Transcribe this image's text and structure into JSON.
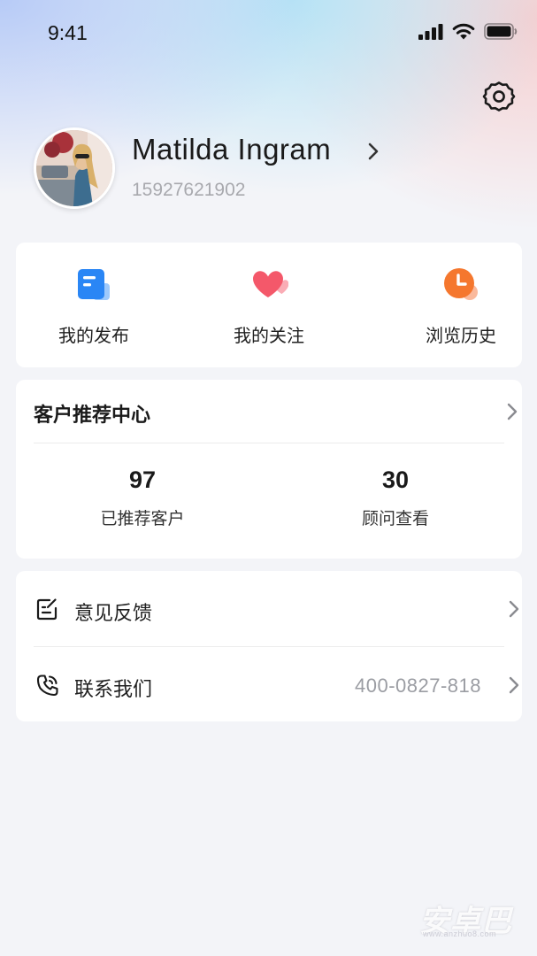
{
  "status_bar": {
    "time": "9:41",
    "icons": [
      "signal-icon",
      "wifi-icon",
      "battery-icon"
    ]
  },
  "header": {
    "settings_icon": "gear-icon"
  },
  "profile": {
    "name": "Matilda Ingram",
    "phone": "15927621902"
  },
  "quick_actions": [
    {
      "label": "我的发布",
      "icon": "document-icon",
      "color": "#2a86f5"
    },
    {
      "label": "我的关注",
      "icon": "heart-icon",
      "color": "#f4586a"
    },
    {
      "label": "浏览历史",
      "icon": "clock-icon",
      "color": "#f5772e"
    }
  ],
  "referral": {
    "title": "客户推荐中心",
    "stats": [
      {
        "value": "97",
        "label": "已推荐客户"
      },
      {
        "value": "30",
        "label": "顾问查看"
      }
    ]
  },
  "menu": [
    {
      "label": "意见反馈",
      "icon": "feedback-edit-icon",
      "value": ""
    },
    {
      "label": "联系我们",
      "icon": "phone-icon",
      "value": "400-0827-818"
    }
  ],
  "watermark": {
    "text": "安卓巴",
    "sub": "www.anzhuo8.com"
  },
  "colors": {
    "background": "#f3f4f8",
    "card": "#ffffff",
    "muted_text": "#a8a9ae"
  }
}
